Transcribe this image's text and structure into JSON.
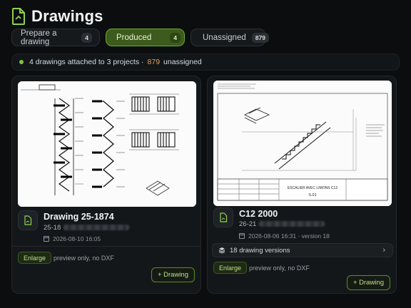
{
  "header": {
    "title": "Drawings",
    "icon": "document-icon"
  },
  "tabs": [
    {
      "label": "Prepare a drawing",
      "count": "4",
      "active": false
    },
    {
      "label": "Produced",
      "count": "4",
      "active": true
    },
    {
      "label": "Unassigned",
      "count": "879",
      "active": false
    }
  ],
  "summary": {
    "text": "4 drawings attached to 3 projects ·",
    "unassigned_count": "879",
    "unassigned_label": "unassigned"
  },
  "cards": [
    {
      "title": "Drawing 25-1874",
      "subtitle": "25-18",
      "date": "2026-08-10 16:05",
      "enlarge_label": "Enlarge",
      "note": "preview only, no DXF",
      "drawing_button": "+ Drawing"
    },
    {
      "title": "C12 2000",
      "subtitle": "26-21",
      "date": "2026-08-06 16:31 · version 18",
      "versions_label": "18 drawing versions",
      "enlarge_label": "Enlarge",
      "note": "preview only, no DXF",
      "drawing_button": "+ Drawing",
      "sheet_title": "ESCALIER AVEC LIMONS C12",
      "sheet_number": "S.01"
    }
  ],
  "colors": {
    "accent": "#7fc241",
    "active_tab": "#3d5b1c",
    "unassigned_num": "#e0a05a"
  }
}
